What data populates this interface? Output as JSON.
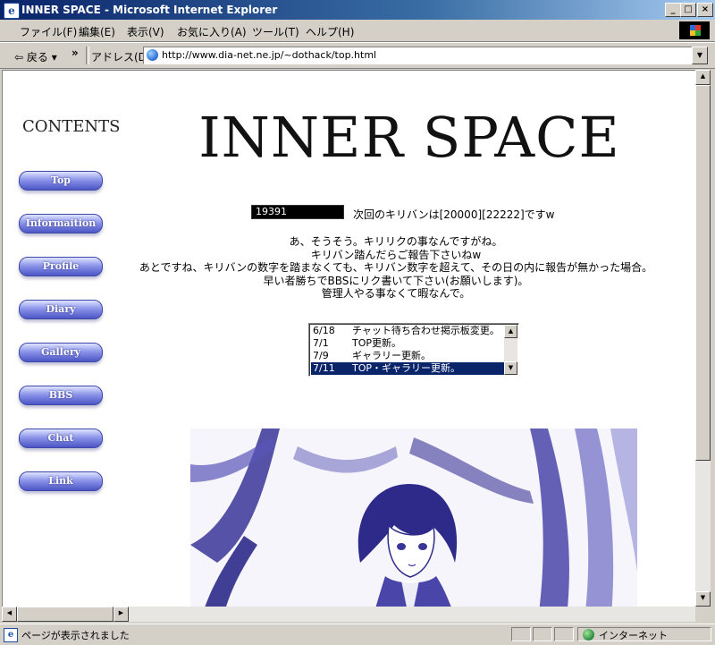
{
  "window": {
    "title": "INNER SPACE - Microsoft Internet Explorer",
    "min_glyph": "_",
    "max_glyph": "□",
    "close_glyph": "×"
  },
  "menu": [
    "ファイル(F)",
    "編集(E)",
    "表示(V)",
    "お気に入り(A)",
    "ツール(T)",
    "ヘルプ(H)"
  ],
  "toolbar": {
    "back_label": "戻る",
    "back_glyph": "⇦",
    "dropdown_glyph": "▾",
    "chevron": "»",
    "address_label": "アドレス(D)",
    "url": "http://www.dia-net.ne.jp/~dothack/top.html"
  },
  "sidebar": {
    "heading": "CONTENTS",
    "items": [
      "Top",
      "Informaition",
      "Profile",
      "Diary",
      "Gallery",
      "BBS",
      "Chat",
      "Link"
    ]
  },
  "main": {
    "title": "INNER SPACE",
    "counter_value": "19391",
    "kiriban_text": "次回のキリバンは[20000][22222]ですw",
    "notice_lines": [
      "あ、そうそう。キリリクの事なんですがね。",
      "キリバン踏んだらご報告下さいねw",
      "あとですね、キリバンの数字を踏まなくても、キリバン数字を超えて、その日の内に報告が無かった場合。",
      "早い者勝ちでBBSにリク書いて下さい(お願いします)。",
      "管理人やる事なくて暇なんで。"
    ],
    "updates": [
      {
        "date": "6/18",
        "text": "チャット待ち合わせ掲示板変更。",
        "selected": false
      },
      {
        "date": "7/1",
        "text": "TOP更新。",
        "selected": false
      },
      {
        "date": "7/9",
        "text": "ギャラリー更新。",
        "selected": false
      },
      {
        "date": "7/11",
        "text": "TOP・ギャラリー更新。",
        "selected": true
      }
    ]
  },
  "scroll": {
    "up": "▲",
    "down": "▼",
    "left": "◀",
    "right": "▶"
  },
  "status": {
    "text": "ページが表示されました",
    "zone": "インターネット"
  },
  "colors": {
    "title_bar": "#0a246a",
    "nav_button": "#6a72d8",
    "illustration_ink": "#2e2a8a",
    "selection": "#0a246a"
  }
}
